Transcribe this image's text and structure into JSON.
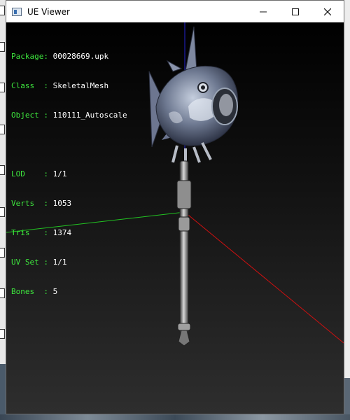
{
  "window": {
    "title": "UE Viewer"
  },
  "info": {
    "package_label": "Package:",
    "package_value": "00028669.upk",
    "class_label": "Class  :",
    "class_value": "SkeletalMesh",
    "object_label": "Object :",
    "object_value": "110111_Autoscale",
    "lod_label": "LOD    :",
    "lod_value": "1/1",
    "verts_label": "Verts  :",
    "verts_value": "1053",
    "tris_label": "Tris   :",
    "tris_value": "1374",
    "uvset_label": "UV Set :",
    "uvset_value": "1/1",
    "bones_label": "Bones  :",
    "bones_value": "5"
  },
  "colors": {
    "label_green": "#3ee63e",
    "axis_x": "#d01010",
    "axis_y": "#22c422",
    "axis_z": "#2222d0"
  }
}
